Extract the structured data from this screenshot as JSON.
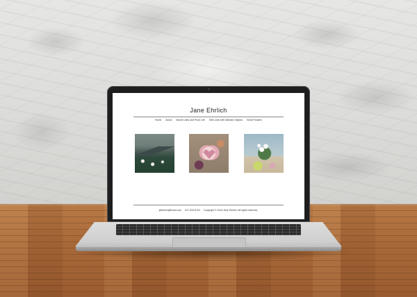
{
  "site": {
    "title": "Jane Ehrlich",
    "nav": [
      "Home",
      "About",
      "Monet Lilies and Pond Life",
      "Still Lives with Intimate Objects",
      "Small Flowers"
    ],
    "footer": {
      "email": "jdehrlich@bsust.com",
      "phone": "617-233-8742",
      "copyright": "Copyright © 2016 Jane Ehrlich. All rights reserved."
    }
  },
  "paintings": [
    {
      "subject": "water lilies on pond",
      "icon": "painting-lilies"
    },
    {
      "subject": "heart-shaped frame still life",
      "icon": "painting-heart"
    },
    {
      "subject": "small white flowers in vase",
      "icon": "painting-flowers"
    }
  ],
  "colors": {
    "wall": "#dcdcda",
    "wood": "#a96a3a",
    "bezel": "#1e1e1f",
    "screen": "#ffffff"
  }
}
